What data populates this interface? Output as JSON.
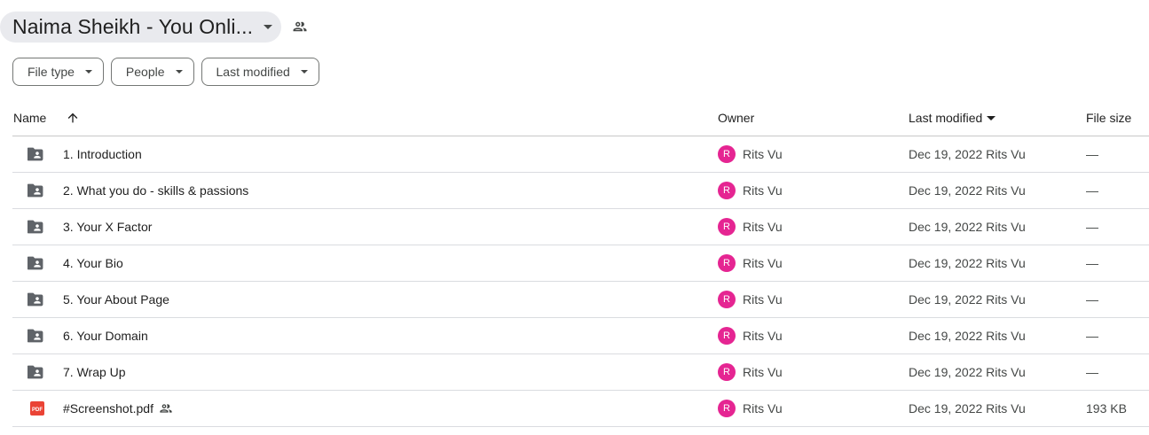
{
  "header": {
    "title": "Naima Sheikh - You Onli...",
    "title_icon": "chevron-down-icon",
    "share_icon": "people-icon"
  },
  "filters": [
    {
      "label": "File type"
    },
    {
      "label": "People"
    },
    {
      "label": "Last modified"
    }
  ],
  "columns": {
    "name": "Name",
    "owner": "Owner",
    "last_modified": "Last modified",
    "file_size": "File size"
  },
  "rows": [
    {
      "name": "1. Introduction",
      "type": "shared-folder",
      "owner": "Rits Vu",
      "avatar": "R",
      "modified": "Dec 19, 2022 Rits Vu",
      "size": "—"
    },
    {
      "name": "2. What you do - skills & passions",
      "type": "shared-folder",
      "owner": "Rits Vu",
      "avatar": "R",
      "modified": "Dec 19, 2022 Rits Vu",
      "size": "—"
    },
    {
      "name": "3. Your X Factor",
      "type": "shared-folder",
      "owner": "Rits Vu",
      "avatar": "R",
      "modified": "Dec 19, 2022 Rits Vu",
      "size": "—"
    },
    {
      "name": "4. Your Bio",
      "type": "shared-folder",
      "owner": "Rits Vu",
      "avatar": "R",
      "modified": "Dec 19, 2022 Rits Vu",
      "size": "—"
    },
    {
      "name": "5. Your About Page",
      "type": "shared-folder",
      "owner": "Rits Vu",
      "avatar": "R",
      "modified": "Dec 19, 2022 Rits Vu",
      "size": "—"
    },
    {
      "name": "6. Your Domain",
      "type": "shared-folder",
      "owner": "Rits Vu",
      "avatar": "R",
      "modified": "Dec 19, 2022 Rits Vu",
      "size": "—"
    },
    {
      "name": "7. Wrap Up",
      "type": "shared-folder",
      "owner": "Rits Vu",
      "avatar": "R",
      "modified": "Dec 19, 2022 Rits Vu",
      "size": "—"
    },
    {
      "name": "#Screenshot.pdf",
      "type": "pdf",
      "pdf_badge": "PDF",
      "owner": "Rits Vu",
      "avatar": "R",
      "modified": "Dec 19, 2022 Rits Vu",
      "size": "193 KB",
      "shared": true
    }
  ],
  "colors": {
    "avatar": "#e52592",
    "pdf": "#ea4335",
    "folder": "#5f6368",
    "title_pill": "#e9eaee"
  }
}
